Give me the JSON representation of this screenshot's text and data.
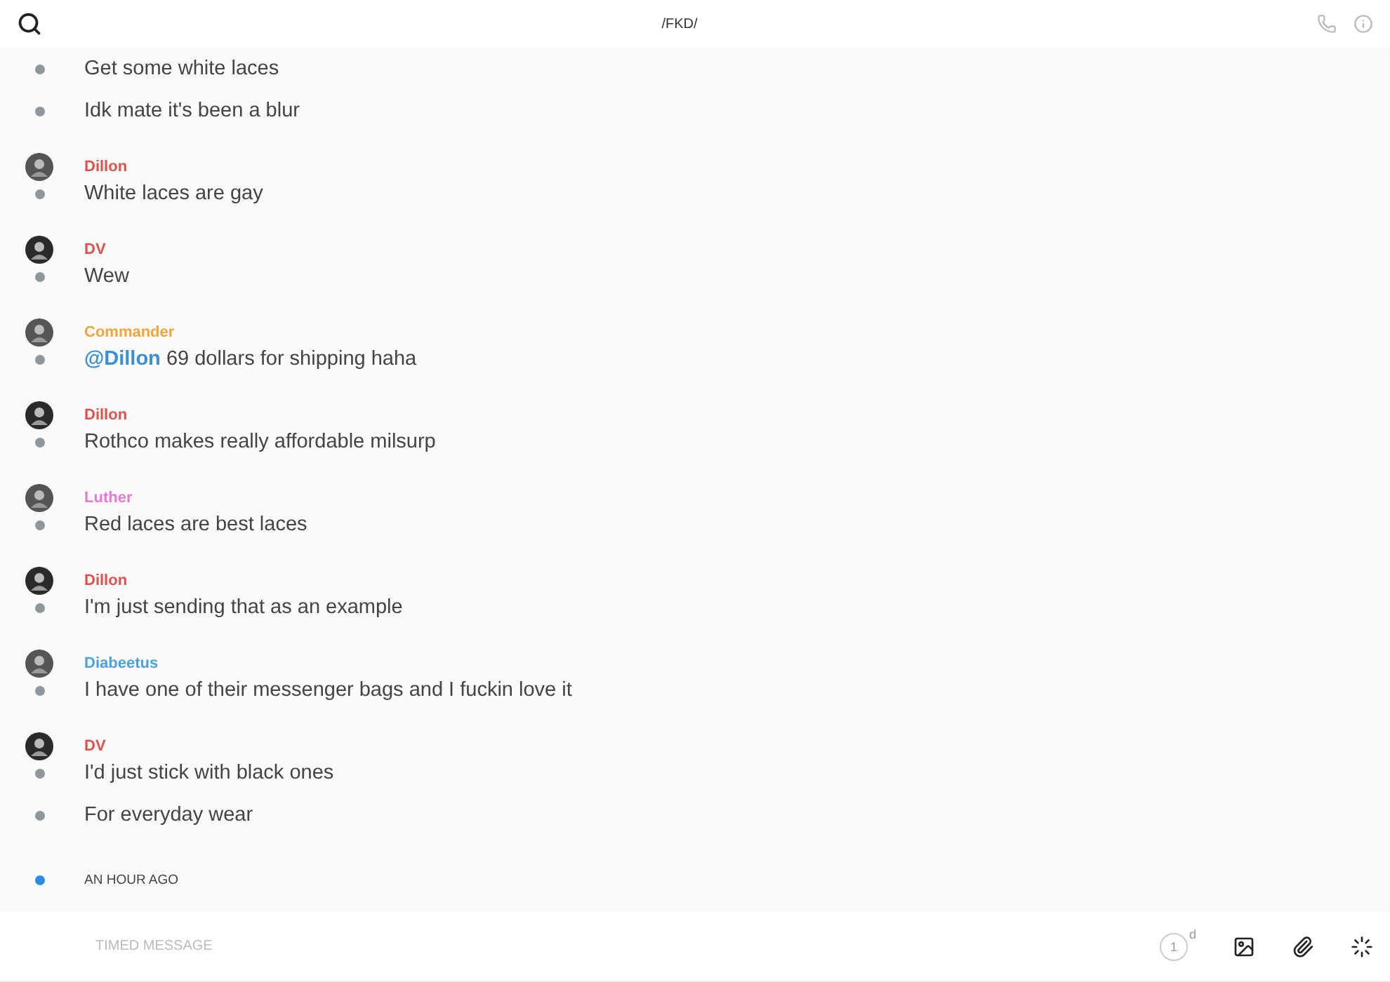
{
  "header": {
    "title": "/FKD/"
  },
  "messages": [
    {
      "kind": "line",
      "text": "Get some white laces"
    },
    {
      "kind": "line",
      "text": "Idk mate it's been a blur"
    },
    {
      "kind": "group",
      "author": "Dillon",
      "color": "#e0504a",
      "text": "White laces are gay"
    },
    {
      "kind": "group",
      "author": "DV",
      "color": "#e0504a",
      "text": "Wew"
    },
    {
      "kind": "group",
      "author": "Commander",
      "color": "#f2a53a",
      "mention": "@Dillon",
      "text": "69 dollars for shipping haha"
    },
    {
      "kind": "group",
      "author": "Dillon",
      "color": "#e0504a",
      "text": "Rothco makes really affordable milsurp"
    },
    {
      "kind": "group",
      "author": "Luther",
      "color": "#e67ad0",
      "text": "Red laces are best laces"
    },
    {
      "kind": "group",
      "author": "Dillon",
      "color": "#e0504a",
      "text": "I'm just sending that as an example"
    },
    {
      "kind": "group",
      "author": "Diabeetus",
      "color": "#4aa3df",
      "text": "I have one of their messenger bags and I fuckin love it"
    },
    {
      "kind": "group",
      "author": "DV",
      "color": "#e0504a",
      "text": "I'd just stick with black ones"
    },
    {
      "kind": "line",
      "text": "For everyday wear"
    },
    {
      "kind": "divider",
      "text": "AN HOUR AGO"
    }
  ],
  "composer": {
    "placeholder": "TIMED MESSAGE",
    "timer": {
      "count": "1",
      "unit": "d"
    }
  }
}
